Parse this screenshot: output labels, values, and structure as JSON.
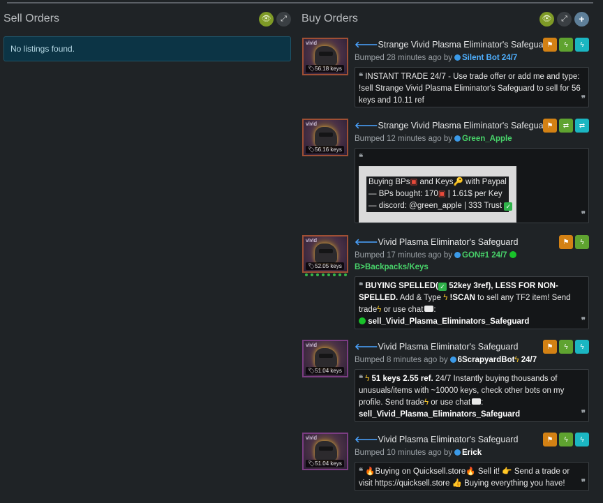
{
  "sell": {
    "title": "Sell Orders",
    "empty_message": "No listings found."
  },
  "buy": {
    "title": "Buy Orders",
    "listings": [
      {
        "quality": "vivid",
        "price": "56.18 keys",
        "name": "Strange Vivid Plasma Eliminator's Safeguard",
        "bumped": "Bumped 28 minutes ago by",
        "user": "Silent Bot 24/7",
        "desc_bold": "INSTANT TRADE 24/7",
        "desc_rest": " - Use trade offer or add me and type: !sell Strange Vivid Plasma Eliminator's Safeguard to sell for 56 keys and 10.11 ref"
      },
      {
        "quality": "vivid",
        "price": "56.16 keys",
        "name": "Strange Vivid Plasma Eliminator's Safeguard",
        "bumped": "Bumped 12 minutes ago by",
        "user": "Green_Apple",
        "line1a": "Buying BPs",
        "line1b": " and Keys",
        "line1c": " with Paypal",
        "line2a": "— BPs bought: 170",
        "line2b": " | 1.61$ per Key",
        "line3": "— discord: @green_apple | 333 Trust"
      },
      {
        "quality": "vivid",
        "price": "52.05 keys",
        "name": "Vivid Plasma Eliminator's Safeguard",
        "bumped": "Bumped 17 minutes ago by",
        "user": "GON#1 24/7",
        "sub": "B>Backpacks/Keys",
        "bold1": "BUYING SPELLED(",
        "bold1b": " 52key 3ref), LESS FOR NON-SPELLED.",
        "text2": " Add & Type ",
        "bold2": "!SCAN",
        "text3": " to sell any TF2 item! Send  trade",
        "text4": " or use  chat",
        "text5": ":",
        "cmd": "sell_Vivid_Plasma_Eliminators_Safeguard"
      },
      {
        "quality": "vivid",
        "price": "51.04 keys",
        "name": "Vivid Plasma Eliminator's Safeguard",
        "bumped": "Bumped 8 minutes ago by",
        "user": "6ScrapyardBot",
        "user_suffix": " 24/7",
        "bold1": " 51 keys 2.55 ref.",
        "text1": " 24/7 Instantly buying thousands of unusuals/items with ~10000 keys, check other bots on my profile. Send  trade",
        "text2": " or  use  chat",
        "text3": ":",
        "cmd": "sell_Vivid_Plasma_Eliminators_Safeguard"
      },
      {
        "quality": "vivid",
        "price": "51.04 keys",
        "name": "Vivid Plasma Eliminator's Safeguard",
        "bumped": "Bumped 10 minutes ago by",
        "user": "Erick",
        "t1": "Buying on Quicksell.store",
        "t2": " Sell it!",
        "t3": " Send a trade or visit https://quicksell.store",
        "t4": " Buying everything you have!"
      }
    ]
  }
}
